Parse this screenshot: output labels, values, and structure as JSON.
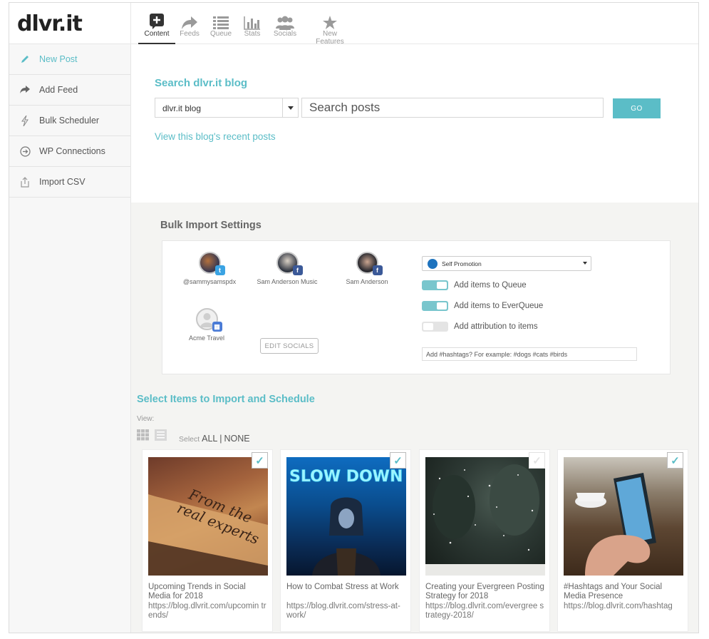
{
  "logo": "dlvr.it",
  "sidebar": {
    "items": [
      {
        "label": "New Post",
        "icon": "pencil-icon",
        "active": true
      },
      {
        "label": "Add Feed",
        "icon": "share-arrow-icon"
      },
      {
        "label": "Bulk Scheduler",
        "icon": "lightning-icon"
      },
      {
        "label": "WP Connections",
        "icon": "sign-in-icon"
      },
      {
        "label": "Import CSV",
        "icon": "upload-icon"
      }
    ]
  },
  "topnav": {
    "tabs": [
      {
        "label": "Content",
        "icon": "plus-box-icon",
        "active": true
      },
      {
        "label": "Feeds",
        "icon": "share-arrow-icon"
      },
      {
        "label": "Queue",
        "icon": "list-icon"
      },
      {
        "label": "Stats",
        "icon": "bar-chart-icon"
      },
      {
        "label": "Socials",
        "icon": "people-icon"
      },
      {
        "label": "New Features",
        "icon": "star-icon"
      }
    ]
  },
  "search": {
    "title": "Search dlvr.it blog",
    "blog_selected": "dlvr.it blog",
    "placeholder": "Search posts",
    "go_label": "GO",
    "recent_link": "View this blog's recent posts"
  },
  "bulk": {
    "title": "Bulk Import Settings",
    "socials": [
      {
        "name": "@sammysamspdx",
        "network": "twitter"
      },
      {
        "name": "Sam Anderson Music",
        "network": "facebook"
      },
      {
        "name": "Sam Anderson",
        "network": "facebook"
      },
      {
        "name": "Acme Travel",
        "network": "google-my-business"
      }
    ],
    "edit_socials_label": "EDIT SOCIALS",
    "category": "Self Promotion",
    "toggles": [
      {
        "label": "Add items to Queue",
        "on": true
      },
      {
        "label": "Add items to EverQueue",
        "on": true
      },
      {
        "label": "Add attribution to items",
        "on": false
      }
    ],
    "hashtags_placeholder": "Add #hashtags? For example: #dogs #cats #birds"
  },
  "select_items": {
    "title": "Select Items to Import and Schedule",
    "view_label": "View:",
    "select_prefix": "Select",
    "select_all": "ALL",
    "select_sep": "|",
    "select_none": "NONE"
  },
  "posts": [
    {
      "title": "Upcoming Trends in Social Media for 2018",
      "url": "https://blog.dlvrit.com/upcomin trends/",
      "checked": true
    },
    {
      "title": "How to Combat Stress at Work",
      "url": "https://blog.dlvrit.com/stress-at-work/",
      "checked": true
    },
    {
      "title": "Creating your Evergreen Posting Strategy for 2018",
      "url": "https://blog.dlvrit.com/evergree strategy-2018/",
      "checked": false
    },
    {
      "title": "#Hashtags and Your Social Media Presence",
      "url": "https://blog.dlvrit.com/hashtag",
      "checked": true
    }
  ],
  "thumb_texts": {
    "neon": "SLOW DOWN",
    "box_line1": "From the",
    "box_line2": "real experts"
  }
}
